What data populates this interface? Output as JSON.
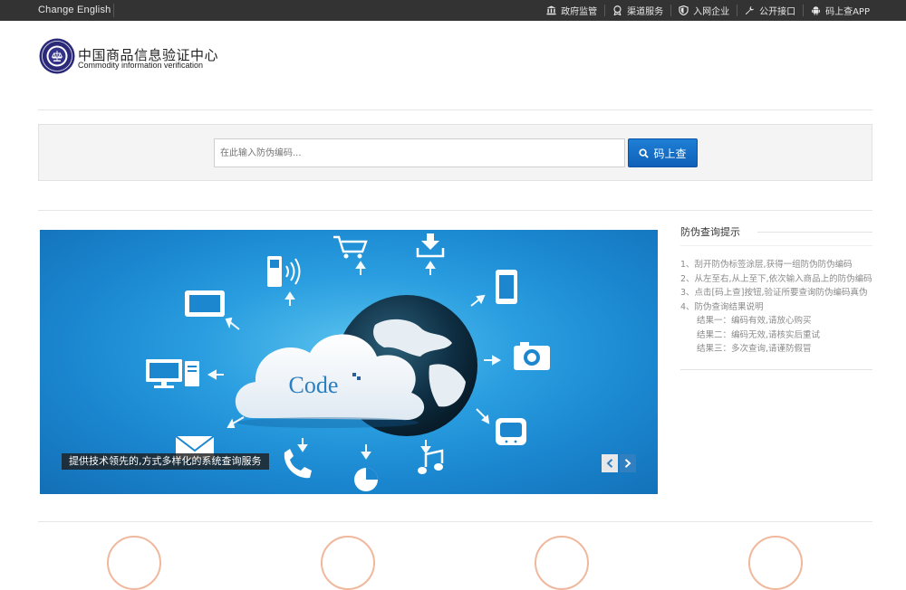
{
  "topbar": {
    "language_link": "Change English",
    "links": [
      {
        "icon": "bank-icon",
        "label": "政府监管"
      },
      {
        "icon": "badge-icon",
        "label": "渠道服务"
      },
      {
        "icon": "shield-icon",
        "label": "入网企业"
      },
      {
        "icon": "wrench-icon",
        "label": "公开接口"
      },
      {
        "icon": "android-icon",
        "label": "码上查APP"
      }
    ]
  },
  "header": {
    "logo_icon": "seal-logo-icon",
    "title_cn": "中国商品信息验证中心",
    "title_en": "Commodity information verification"
  },
  "search": {
    "placeholder": "在此输入防伪编码...",
    "button_label": "码上查",
    "button_icon": "search-icon",
    "button_color": "#1570c8"
  },
  "banner": {
    "center_label": "Code",
    "caption": "提供技术领先的,方式多样化的系统查询服务",
    "icons": [
      "cart-icon",
      "download-icon",
      "mobile-phone-icon",
      "tablet-icon",
      "smartphone-icon",
      "computer-icon",
      "camera-icon",
      "envelope-icon",
      "phone-icon",
      "pie-chart-icon",
      "music-icon",
      "tv-icon"
    ]
  },
  "tips": {
    "title": "防伪查询提示",
    "items": [
      "1、刮开防伪标签涂层,获得一组防伪防伪编码",
      "2、从左至右,从上至下,依次输入商品上的防伪编码",
      "3、点击[码上查]按钮,验证所要查询防伪编码真伪",
      "4、防伪查询结果说明"
    ],
    "results": [
      "结果一：编码有效,请放心购买",
      "结果二：编码无效,请核实后重试",
      "结果三：多次查询,请谨防假冒"
    ]
  },
  "colors": {
    "topbar_bg": "#333333",
    "accent_blue": "#1570c8",
    "banner_blue": "#1a86cf"
  }
}
